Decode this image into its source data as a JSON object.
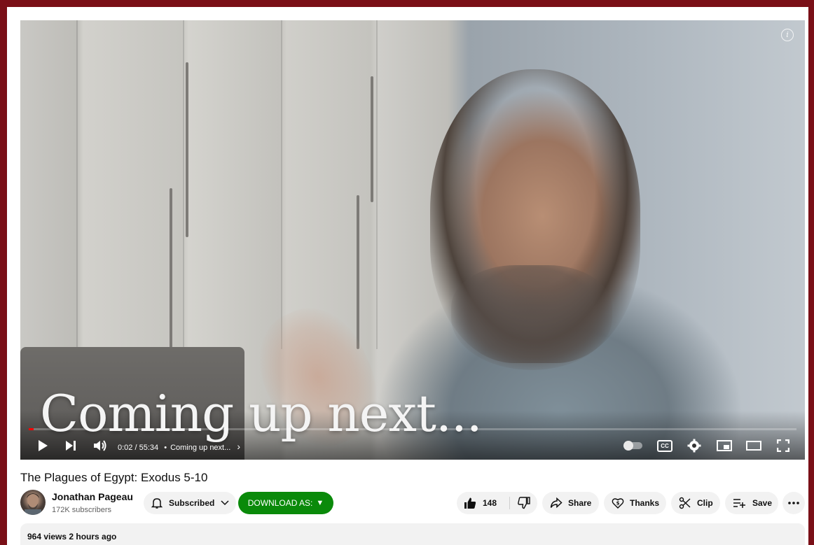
{
  "video": {
    "overlay_text": "Coming up next...",
    "progress_fraction": 0.0006,
    "time_current": "0:02",
    "time_separator": "/",
    "time_total": "55:34",
    "chapter_dot": "•",
    "chapter_label": "Coming up next...",
    "chapter_arrow": "›"
  },
  "title": "The Plagues of Egypt: Exodus 5-10",
  "channel": {
    "name": "Jonathan Pageau",
    "subscribers": "172K subscribers"
  },
  "actions": {
    "subscribe_label": "Subscribed",
    "download_label": "DOWNLOAD AS:",
    "download_arrow": "▼",
    "like_count": "148",
    "share_label": "Share",
    "thanks_label": "Thanks",
    "clip_label": "Clip",
    "save_label": "Save"
  },
  "description": {
    "meta": "964 views  2 hours ago"
  },
  "colors": {
    "frame": "#7a0f17",
    "download_button": "#0a8a0a",
    "progress": "#ff0000"
  },
  "icons": [
    "info-icon",
    "play-icon",
    "next-icon",
    "volume-icon",
    "autoplay-toggle",
    "captions-icon",
    "settings-icon",
    "miniplayer-icon",
    "theater-icon",
    "fullscreen-icon",
    "bell-icon",
    "chevron-down-icon",
    "thumbs-up-icon",
    "thumbs-down-icon",
    "share-icon",
    "thanks-icon",
    "scissors-icon",
    "playlist-add-icon",
    "more-icon"
  ]
}
